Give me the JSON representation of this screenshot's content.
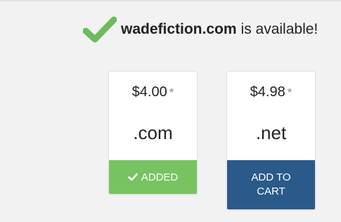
{
  "availability": {
    "domain": "wadefiction.com",
    "status_text": "is available!",
    "icon": "check-icon",
    "color": "#6dbb5f"
  },
  "offers": [
    {
      "price": "$4.00",
      "asterisk": "*",
      "tld": ".com",
      "button_label": "ADDED",
      "button_icon": "check-icon",
      "button_color": "#77c362"
    },
    {
      "price": "$4.98",
      "asterisk": "*",
      "tld": ".net",
      "button_label_line1": "ADD TO",
      "button_label_line2": "CART",
      "button_color": "#2a5a8a"
    }
  ]
}
